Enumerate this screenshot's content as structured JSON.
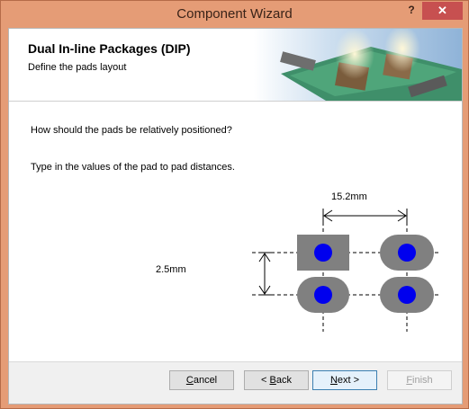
{
  "window": {
    "title": "Component Wizard",
    "help_label": "?",
    "close_label": "✕"
  },
  "header": {
    "title": "Dual In-line Packages (DIP)",
    "subtitle": "Define the pads layout"
  },
  "body": {
    "question": "How should the pads be relatively positioned?",
    "instruction": "Type in the values of the pad to pad distances."
  },
  "diagram": {
    "horizontal_distance": "15.2mm",
    "vertical_distance": "2.5mm",
    "colors": {
      "pad": "#808080",
      "hole": "#0000ee"
    }
  },
  "footer": {
    "cancel": {
      "prefix": "",
      "mnemonic": "C",
      "rest": "ancel"
    },
    "back": {
      "prefix": "< ",
      "mnemonic": "B",
      "rest": "ack"
    },
    "next": {
      "prefix": "",
      "mnemonic": "N",
      "rest": "ext >"
    },
    "finish": {
      "prefix": "",
      "mnemonic": "F",
      "rest": "inish"
    }
  }
}
